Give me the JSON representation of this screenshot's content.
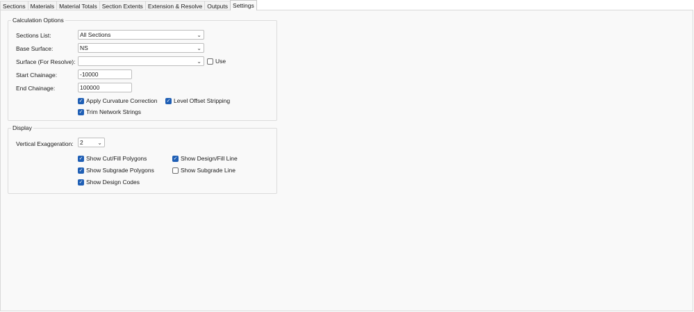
{
  "tabs": [
    {
      "label": "Sections"
    },
    {
      "label": "Materials"
    },
    {
      "label": "Material Totals"
    },
    {
      "label": "Section Extents"
    },
    {
      "label": "Extension & Resolve"
    },
    {
      "label": "Outputs"
    },
    {
      "label": "Settings",
      "active": true
    }
  ],
  "calc": {
    "title": "Calculation Options",
    "sections_list": {
      "label": "Sections List:",
      "value": "All Sections"
    },
    "base_surface": {
      "label": "Base Surface:",
      "value": "NS"
    },
    "resolve_surface": {
      "label": "Surface (For Resolve):",
      "value": "",
      "use_label": "Use",
      "use_checked": false
    },
    "start_chainage": {
      "label": "Start Chainage:",
      "value": "-10000"
    },
    "end_chainage": {
      "label": "End Chainage:",
      "value": "100000"
    },
    "apply_curvature": {
      "label": "Apply Curvature Correction",
      "checked": true
    },
    "level_offset": {
      "label": "Level Offset Stripping",
      "checked": true
    },
    "trim_network": {
      "label": "Trim Network Strings",
      "checked": true
    }
  },
  "display": {
    "title": "Display",
    "vertical_exaggeration": {
      "label": "Vertical Exaggeration:",
      "value": "2"
    },
    "show_cut_fill": {
      "label": "Show Cut/Fill Polygons",
      "checked": true
    },
    "show_design_fill_line": {
      "label": "Show Design/Fill Line",
      "checked": true
    },
    "show_subgrade_polygons": {
      "label": "Show Subgrade Polygons",
      "checked": true
    },
    "show_subgrade_line": {
      "label": "Show Subgrade Line",
      "checked": false
    },
    "show_design_codes": {
      "label": "Show Design Codes",
      "checked": true
    }
  },
  "icons": {
    "check": "check-icon",
    "dropdown": "chevron-down-icon"
  },
  "colors": {
    "accent": "#1f5fb5",
    "panel": "#f9f9f9"
  }
}
